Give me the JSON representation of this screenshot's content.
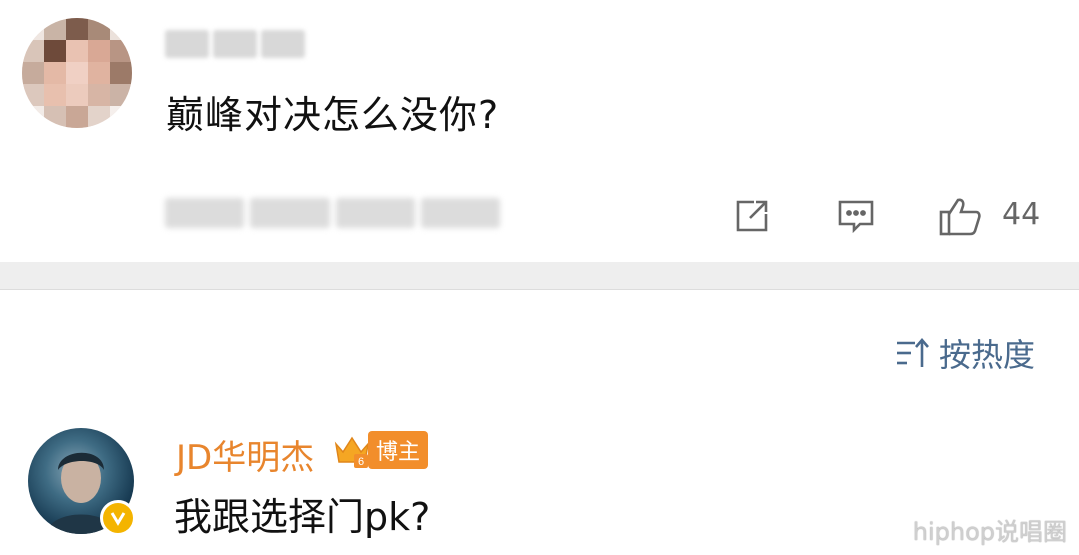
{
  "top_comment": {
    "text": "巅峰对决怎么没你?",
    "like_count": "44"
  },
  "sort": {
    "label": "按热度"
  },
  "reply": {
    "user_name": "JD华明杰",
    "badge_label": "博主",
    "crown_level": "6",
    "text": "我跟选择门pk?"
  },
  "watermark": "hiphop说唱圈",
  "colors": {
    "username": "#e8852d",
    "sort_label": "#4a6a8d",
    "badge": "#f28e2b",
    "verified": "#f4b400"
  },
  "icons": {
    "share": "share-icon",
    "comment": "comment-icon",
    "like": "thumbs-up-icon",
    "sort": "sort-icon",
    "crown": "crown-icon",
    "verified": "verified-icon"
  }
}
